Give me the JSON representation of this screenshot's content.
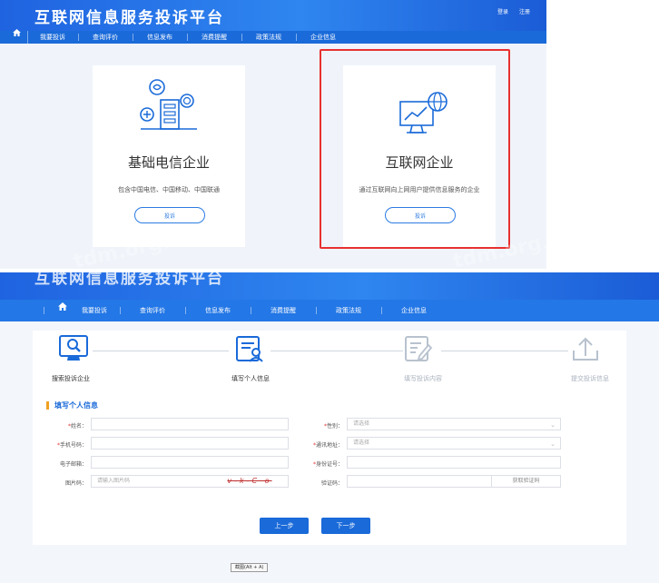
{
  "header": {
    "title": "互联网信息服务投诉平台",
    "login": "登录",
    "register": "注册"
  },
  "nav": {
    "items": [
      "我要投诉",
      "查询评价",
      "信息发布",
      "消费提醒",
      "政策法规",
      "企业信息"
    ]
  },
  "cards": [
    {
      "title": "基础电信企业",
      "desc": "包含中国电信、中国移动、中国联通",
      "button": "投诉"
    },
    {
      "title": "互联网企业",
      "desc": "通过互联网向上网用户提供信息服务的企业",
      "button": "投诉"
    }
  ],
  "watermark": "tdm.org.cn",
  "steps": [
    "搜索投诉企业",
    "填写个人信息",
    "填写投诉内容",
    "提交投诉信息"
  ],
  "form": {
    "section_title": "填写个人信息",
    "fields": {
      "name": {
        "label": "姓名："
      },
      "gender": {
        "label": "性别：",
        "placeholder": "请选择"
      },
      "phone": {
        "label": "手机号码："
      },
      "address": {
        "label": "通讯地址：",
        "placeholder": "请选择"
      },
      "email": {
        "label": "电子邮箱："
      },
      "idcard": {
        "label": "身份证号："
      },
      "captcha": {
        "label": "图片码：",
        "placeholder": "请输入图片码",
        "image_text": "v-k-C o"
      },
      "sms": {
        "label": "验证码：",
        "button": "获取验证码"
      }
    },
    "prev": "上一步",
    "next": "下一步"
  },
  "footer_hint": "截图(Alt + A)",
  "colors": {
    "brand": "#1a6ad9",
    "highlight": "#e83030",
    "required": "#e83030",
    "accent": "#f0a020"
  }
}
